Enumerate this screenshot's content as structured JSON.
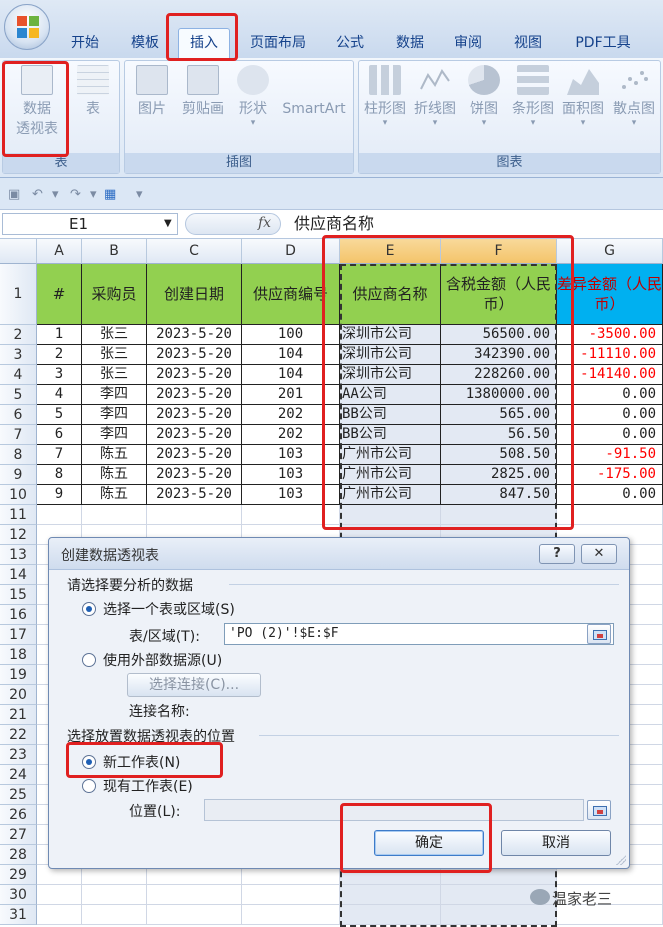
{
  "ribbon": {
    "tabs": [
      "开始",
      "模板",
      "插入",
      "页面布局",
      "公式",
      "数据",
      "审阅",
      "视图",
      "PDF工具"
    ],
    "active_tab": "插入",
    "groups": {
      "table": {
        "label": "表",
        "buttons": [
          {
            "line1": "数据",
            "line2": "透视表"
          },
          {
            "line1": "表",
            "line2": ""
          }
        ]
      },
      "illustrations": {
        "label": "插图",
        "buttons": [
          "图片",
          "剪贴画",
          "形状",
          "SmartArt"
        ]
      },
      "charts": {
        "label": "图表",
        "buttons": [
          "柱形图",
          "折线图",
          "饼图",
          "条形图",
          "面积图",
          "散点图"
        ]
      }
    }
  },
  "formula_bar": {
    "name_box": "E1",
    "fx": "fx",
    "content": "供应商名称"
  },
  "sheet": {
    "columns": [
      "A",
      "B",
      "C",
      "D",
      "E",
      "F",
      "G"
    ],
    "rows": [
      "1",
      "2",
      "3",
      "4",
      "5",
      "6",
      "7",
      "8",
      "9",
      "10",
      "11",
      "12",
      "13",
      "14",
      "15",
      "16",
      "17",
      "18",
      "19",
      "20",
      "21",
      "22",
      "23",
      "24",
      "25",
      "26",
      "27",
      "28",
      "29",
      "30",
      "31"
    ],
    "headers": [
      "#",
      "采购员",
      "创建日期",
      "供应商编号",
      "供应商名称",
      "含税金额（人民币）",
      "差异金额（人民币）"
    ],
    "data": [
      [
        "1",
        "张三",
        "2023-5-20",
        "100",
        "深圳市公司",
        "56500.00",
        "-3500.00"
      ],
      [
        "2",
        "张三",
        "2023-5-20",
        "104",
        "深圳市公司",
        "342390.00",
        "-11110.00"
      ],
      [
        "3",
        "张三",
        "2023-5-20",
        "104",
        "深圳市公司",
        "228260.00",
        "-14140.00"
      ],
      [
        "4",
        "李四",
        "2023-5-20",
        "201",
        "AA公司",
        "1380000.00",
        "0.00"
      ],
      [
        "5",
        "李四",
        "2023-5-20",
        "202",
        "BB公司",
        "565.00",
        "0.00"
      ],
      [
        "6",
        "李四",
        "2023-5-20",
        "202",
        "BB公司",
        "56.50",
        "0.00"
      ],
      [
        "7",
        "陈五",
        "2023-5-20",
        "103",
        "广州市公司",
        "508.50",
        "-91.50"
      ],
      [
        "8",
        "陈五",
        "2023-5-20",
        "103",
        "广州市公司",
        "2825.00",
        "-175.00"
      ],
      [
        "9",
        "陈五",
        "2023-5-20",
        "103",
        "广州市公司",
        "847.50",
        "0.00"
      ]
    ]
  },
  "dialog": {
    "title": "创建数据透视表",
    "help": "?",
    "close": "✕",
    "section1": "请选择要分析的数据",
    "opt_table": "选择一个表或区域(S)",
    "range_label": "表/区域(T):",
    "range_value": "'PO (2)'!$E:$F",
    "opt_external": "使用外部数据源(U)",
    "choose_conn": "选择连接(C)...",
    "conn_name": "连接名称:",
    "section2": "选择放置数据透视表的位置",
    "opt_new": "新工作表(N)",
    "opt_existing": "现有工作表(E)",
    "location_label": "位置(L):",
    "ok": "确定",
    "cancel": "取消"
  },
  "watermark": "温家老三",
  "colors": {
    "header_green": "#92d050",
    "header_blue": "#00b0f0",
    "annotation_red": "#e02020",
    "negative": "#ff0000"
  }
}
